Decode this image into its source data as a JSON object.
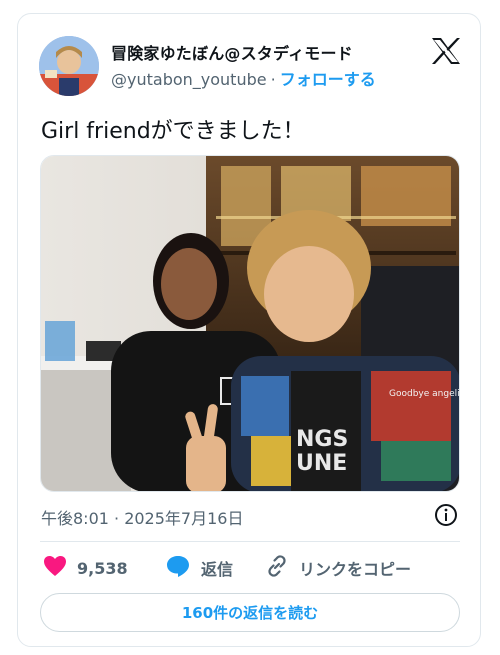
{
  "author": {
    "display_name": "冒険家ゆたぼん@スタディモード",
    "handle": "@yutabon_youtube",
    "separator": "·",
    "follow_label": "フォローする"
  },
  "tweet": {
    "text": "Girl friendができました！",
    "timestamp": "午後8:01 · 2025年7月16日"
  },
  "photo": {
    "shirt_print_1": "NGS",
    "shirt_print_2": "UNE",
    "jacket_print": "Goodbye angelina"
  },
  "actions": {
    "likes_count": "9,538",
    "reply_label": "返信",
    "copy_link_label": "リンクをコピー"
  },
  "read_replies_label": "160件の返信を読む",
  "colors": {
    "accent": "#1d9bf0",
    "like": "#f91880",
    "secondary_text": "#536471",
    "border": "#e1e8ed"
  },
  "icons": [
    "x-logo-icon",
    "info-icon",
    "heart-icon",
    "reply-bubble-icon",
    "link-icon"
  ]
}
